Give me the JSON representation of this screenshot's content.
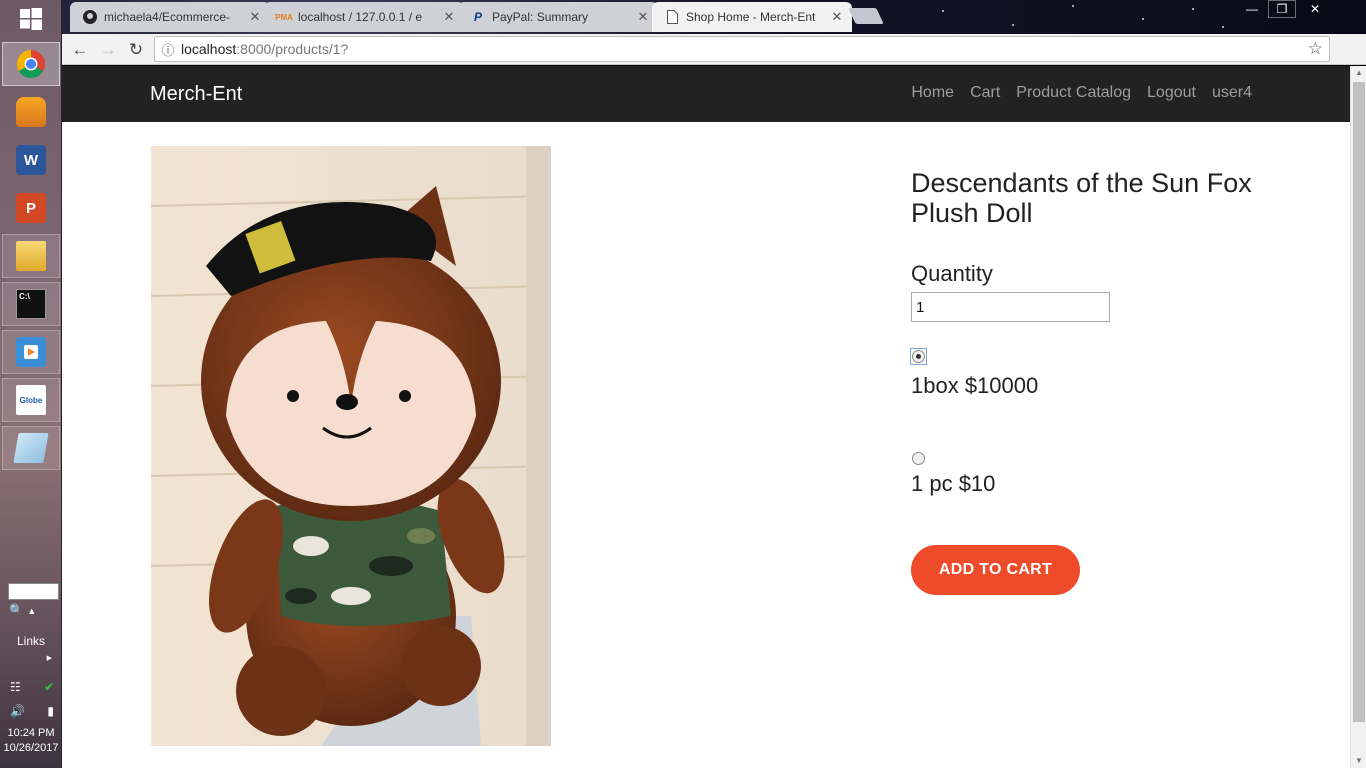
{
  "tabs": [
    {
      "title": "michaela4/Ecommerce-",
      "icon": "github-icon"
    },
    {
      "title": "localhost / 127.0.0.1 / e",
      "icon": "phpmyadmin-icon"
    },
    {
      "title": "PayPal: Summary",
      "icon": "paypal-icon"
    },
    {
      "title": "Shop Home - Merch-Ent",
      "icon": "page-icon"
    }
  ],
  "address": {
    "host": "localhost",
    "path": ":8000/products/1?"
  },
  "taskbar": {
    "links_label": "Links",
    "time": "10:24 PM",
    "date": "10/26/2017"
  },
  "site": {
    "brand": "Merch-Ent",
    "nav": [
      "Home",
      "Cart",
      "Product Catalog",
      "Logout",
      "user4"
    ]
  },
  "product": {
    "title": "Descendants of the Sun Fox Plush Doll",
    "quantity_label": "Quantity",
    "quantity_value": "1",
    "options": [
      {
        "label": "1box $10000",
        "selected": true
      },
      {
        "label": "1 pc $10",
        "selected": false
      }
    ],
    "add_to_cart": "ADD TO CART"
  },
  "colors": {
    "navbar": "#222222",
    "accent": "#ee4b2b"
  }
}
